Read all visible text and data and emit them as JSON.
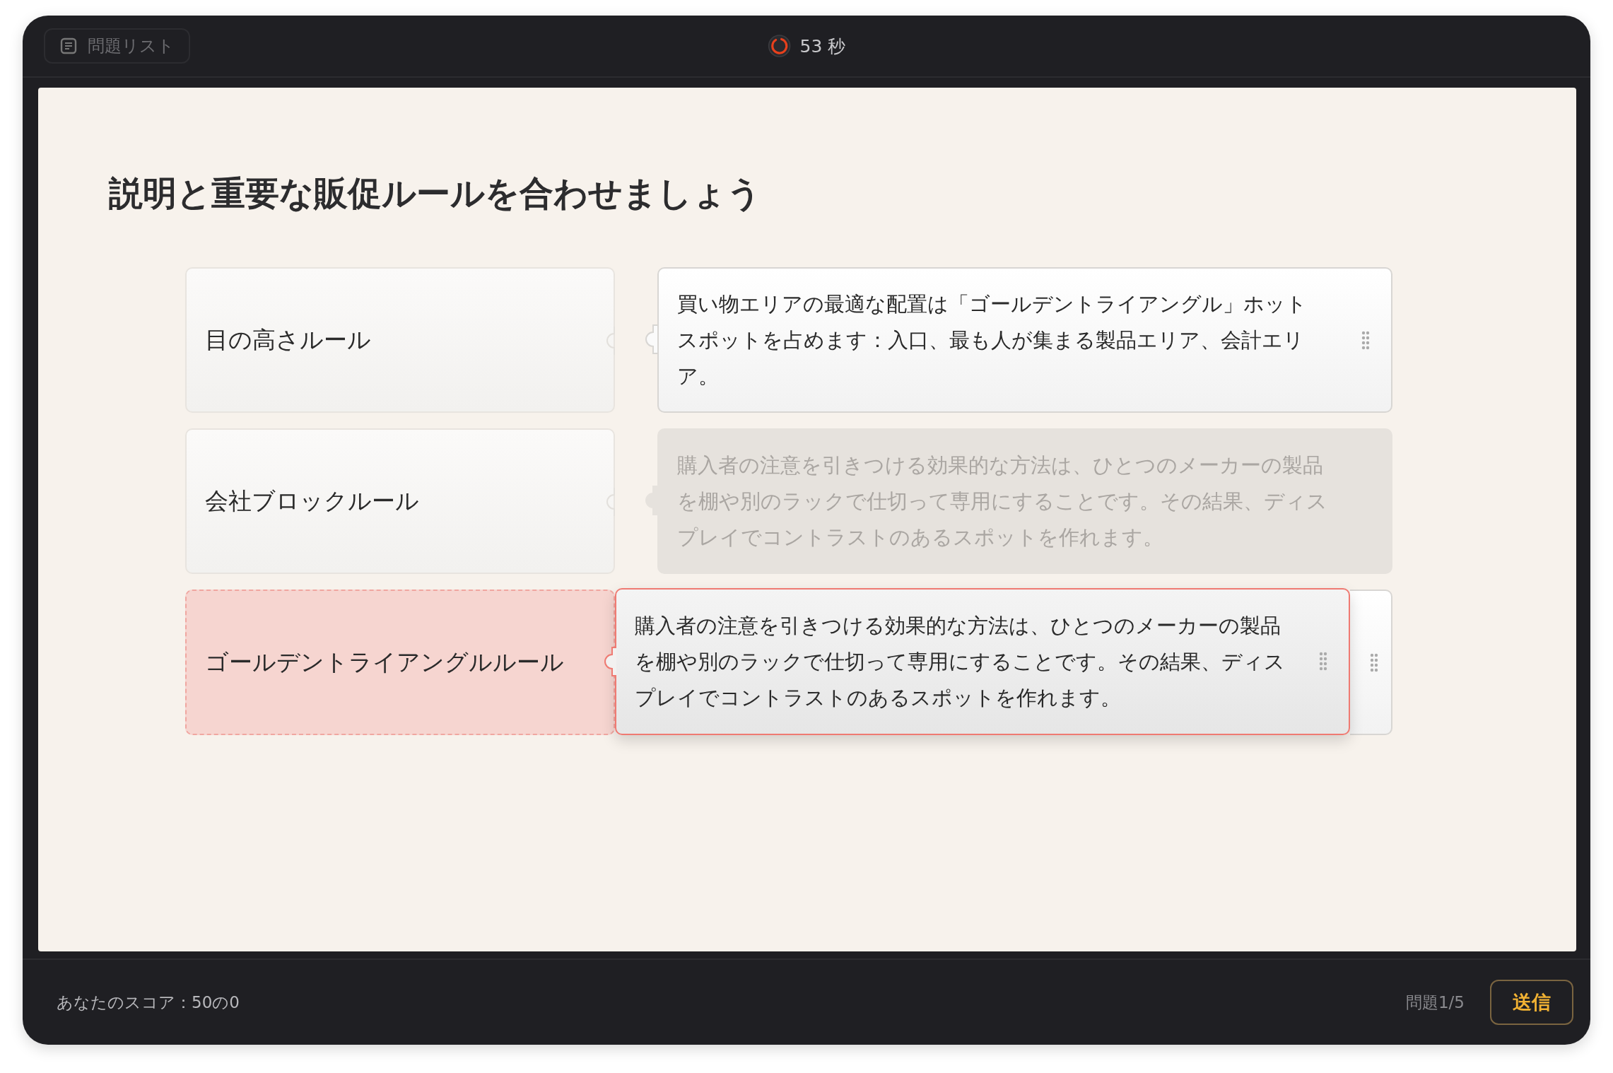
{
  "top_bar": {
    "question_list_button": "問題リスト",
    "timer": "53 秒"
  },
  "question": {
    "title": "説明と重要な販促ルールを合わせましょう"
  },
  "rows": [
    {
      "term": {
        "text": "目の高さルール",
        "kind": "normal"
      },
      "answer": {
        "kind": "placed",
        "text": "買い物エリアの最適な配置は「ゴールデントライアングル」ホットスポットを占めます：入口、最も人が集まる製品エリア、会計エリア。"
      }
    },
    {
      "term": {
        "text": "会社ブロックルール",
        "kind": "normal"
      },
      "answer": {
        "kind": "ghost",
        "text": "購入者の注意を引きつける効果的な方法は、ひとつのメーカーの製品を棚や別のラックで仕切って専用にすることです。その結果、ディスプレイでコントラストのあるスポットを作れます。"
      }
    },
    {
      "term": {
        "text": "ゴールデントライアングルルール",
        "kind": "target"
      },
      "answer": {
        "kind": "empty"
      },
      "dragged_card": {
        "text": "購入者の注意を引きつける効果的な方法は、ひとつのメーカーの製品を棚や別のラックで仕切って専用にすることです。その結果、ディスプレイでコントラストのあるスポットを作れます。"
      }
    }
  ],
  "footer": {
    "score": "あなたのスコア：50の0",
    "progress": "問題1/5",
    "submit_button": "送信"
  }
}
